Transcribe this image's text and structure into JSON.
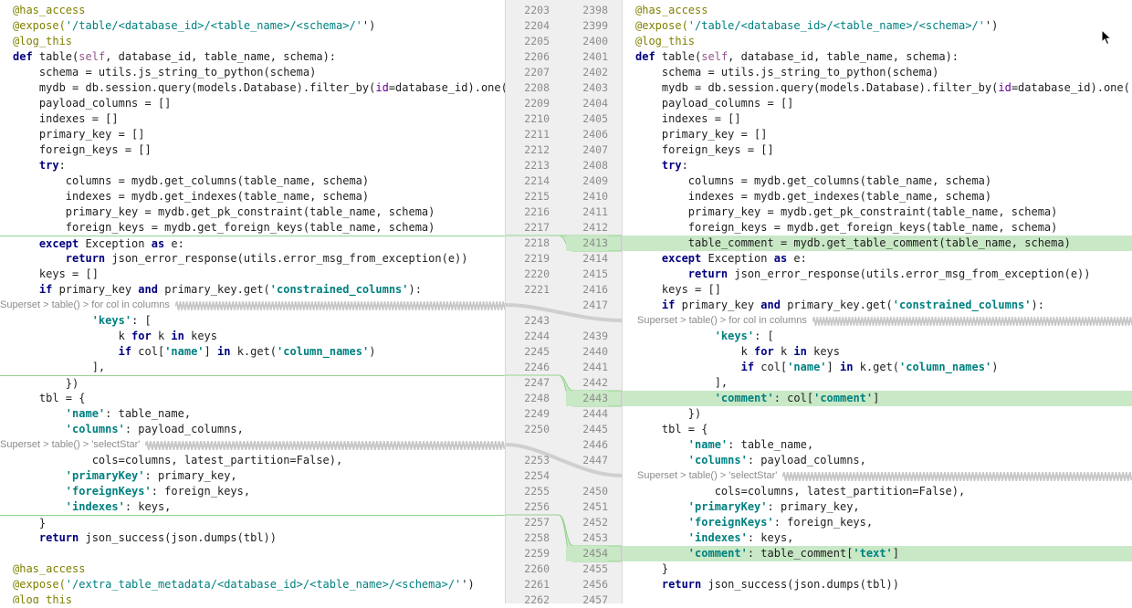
{
  "left": [
    {
      "t": "code",
      "n": "2203",
      "c": [
        [
          "d",
          "@has_access"
        ]
      ]
    },
    {
      "t": "code",
      "n": "2204",
      "c": [
        [
          "d",
          "@expose("
        ],
        [
          "sp",
          "'/table/<database_id>/<table_name>/<schema>/'"
        ],
        [
          "",
          "')"
        ]
      ]
    },
    {
      "t": "code",
      "n": "2205",
      "c": [
        [
          "d",
          "@log_this"
        ]
      ]
    },
    {
      "t": "code",
      "n": "2206",
      "c": [
        [
          "k",
          "def "
        ],
        [
          "",
          "table("
        ],
        [
          "sf",
          "self"
        ],
        [
          "",
          ", database_id, table_name, schema):"
        ]
      ]
    },
    {
      "t": "code",
      "n": "2207",
      "c": [
        [
          "",
          "    schema = utils.js_string_to_python(schema)"
        ]
      ]
    },
    {
      "t": "code",
      "n": "2208",
      "c": [
        [
          "",
          "    mydb = db.session.query(models.Database).filter_by("
        ],
        [
          "pr",
          "id"
        ],
        [
          "",
          "=database_id).one()"
        ]
      ]
    },
    {
      "t": "code",
      "n": "2209",
      "c": [
        [
          "",
          "    payload_columns = []"
        ]
      ]
    },
    {
      "t": "code",
      "n": "2210",
      "c": [
        [
          "",
          "    indexes = []"
        ]
      ]
    },
    {
      "t": "code",
      "n": "2211",
      "c": [
        [
          "",
          "    primary_key = []"
        ]
      ]
    },
    {
      "t": "code",
      "n": "2212",
      "c": [
        [
          "",
          "    foreign_keys = []"
        ]
      ]
    },
    {
      "t": "code",
      "n": "2213",
      "c": [
        [
          "k",
          "    try"
        ],
        [
          "",
          ":"
        ]
      ]
    },
    {
      "t": "code",
      "n": "2214",
      "c": [
        [
          "",
          "        columns = mydb.get_columns(table_name, schema)"
        ]
      ]
    },
    {
      "t": "code",
      "n": "2215",
      "c": [
        [
          "",
          "        indexes = mydb.get_indexes(table_name, schema)"
        ]
      ]
    },
    {
      "t": "code",
      "n": "2216",
      "c": [
        [
          "",
          "        primary_key = mydb.get_pk_constraint(table_name, schema)"
        ]
      ]
    },
    {
      "t": "code",
      "n": "2217",
      "c": [
        [
          "",
          "        foreign_keys = mydb.get_foreign_keys(table_name, schema)"
        ]
      ]
    },
    {
      "t": "code",
      "n": "2218",
      "mark": true,
      "c": [
        [
          "k",
          "    except "
        ],
        [
          "",
          "Exception "
        ],
        [
          "k",
          "as "
        ],
        [
          "",
          "e:"
        ]
      ]
    },
    {
      "t": "code",
      "n": "2219",
      "c": [
        [
          "k",
          "        return "
        ],
        [
          "",
          "json_error_response(utils.error_msg_from_exception(e))"
        ]
      ]
    },
    {
      "t": "code",
      "n": "2220",
      "c": [
        [
          "",
          "    keys = []"
        ]
      ]
    },
    {
      "t": "code",
      "n": "2221",
      "c": [
        [
          "k",
          "    if "
        ],
        [
          "",
          "primary_key "
        ],
        [
          "k",
          "and "
        ],
        [
          "",
          "primary_key.get("
        ],
        [
          "s",
          "'constrained_columns'"
        ],
        [
          "",
          "):"
        ]
      ]
    },
    {
      "t": "fold",
      "n": "",
      "label": "Superset > table() > for col in columns"
    },
    {
      "t": "code",
      "n": "2243",
      "c": [
        [
          "",
          "            "
        ],
        [
          "s",
          "'keys'"
        ],
        [
          "",
          ": ["
        ]
      ]
    },
    {
      "t": "code",
      "n": "2244",
      "c": [
        [
          "",
          "                k "
        ],
        [
          "k",
          "for "
        ],
        [
          "",
          "k "
        ],
        [
          "k",
          "in "
        ],
        [
          "",
          "keys"
        ]
      ]
    },
    {
      "t": "code",
      "n": "2245",
      "c": [
        [
          "k",
          "                if "
        ],
        [
          "",
          "col["
        ],
        [
          "s",
          "'name'"
        ],
        [
          "",
          "] "
        ],
        [
          "k",
          "in "
        ],
        [
          "",
          "k.get("
        ],
        [
          "s",
          "'column_names'"
        ],
        [
          "",
          ")"
        ]
      ]
    },
    {
      "t": "code",
      "n": "2246",
      "c": [
        [
          "",
          "            ],"
        ]
      ]
    },
    {
      "t": "code",
      "n": "2247",
      "mark": true,
      "c": [
        [
          "",
          "        })"
        ]
      ]
    },
    {
      "t": "code",
      "n": "2248",
      "c": [
        [
          "",
          "    tbl = {"
        ]
      ]
    },
    {
      "t": "code",
      "n": "2249",
      "c": [
        [
          "",
          "        "
        ],
        [
          "s",
          "'name'"
        ],
        [
          "",
          ": table_name,"
        ]
      ]
    },
    {
      "t": "code",
      "n": "2250",
      "c": [
        [
          "",
          "        "
        ],
        [
          "s",
          "'columns'"
        ],
        [
          "",
          ": payload_columns,"
        ]
      ]
    },
    {
      "t": "fold",
      "n": "",
      "label": "Superset > table() > 'selectStar'"
    },
    {
      "t": "code",
      "n": "2253",
      "c": [
        [
          "",
          "            cols=columns, latest_partition=False),"
        ]
      ]
    },
    {
      "t": "code",
      "n": "2254",
      "c": [
        [
          "",
          "        "
        ],
        [
          "s",
          "'primaryKey'"
        ],
        [
          "",
          ": primary_key,"
        ]
      ]
    },
    {
      "t": "code",
      "n": "2255",
      "c": [
        [
          "",
          "        "
        ],
        [
          "s",
          "'foreignKeys'"
        ],
        [
          "",
          ": foreign_keys,"
        ]
      ]
    },
    {
      "t": "code",
      "n": "2256",
      "c": [
        [
          "",
          "        "
        ],
        [
          "s",
          "'indexes'"
        ],
        [
          "",
          ": keys,"
        ]
      ]
    },
    {
      "t": "code",
      "n": "2257",
      "mark": true,
      "c": [
        [
          "",
          "    }"
        ]
      ]
    },
    {
      "t": "code",
      "n": "2258",
      "c": [
        [
          "k",
          "    return "
        ],
        [
          "",
          "json_success(json.dumps(tbl))"
        ]
      ]
    },
    {
      "t": "code",
      "n": "2259",
      "c": [
        [
          "",
          ""
        ]
      ]
    },
    {
      "t": "code",
      "n": "2260",
      "c": [
        [
          "d",
          "@has_access"
        ]
      ]
    },
    {
      "t": "code",
      "n": "2261",
      "c": [
        [
          "d",
          "@expose("
        ],
        [
          "sp",
          "'/extra_table_metadata/<database_id>/<table_name>/<schema>/'"
        ],
        [
          "",
          "')"
        ]
      ]
    },
    {
      "t": "code",
      "n": "2262",
      "c": [
        [
          "d",
          "@log_this"
        ]
      ]
    }
  ],
  "right": [
    {
      "t": "code",
      "n": "2398",
      "c": [
        [
          "d",
          "@has_access"
        ]
      ]
    },
    {
      "t": "code",
      "n": "2399",
      "c": [
        [
          "d",
          "@expose("
        ],
        [
          "sp",
          "'/table/<database_id>/<table_name>/<schema>/'"
        ],
        [
          "",
          "')"
        ]
      ]
    },
    {
      "t": "code",
      "n": "2400",
      "c": [
        [
          "d",
          "@log_this"
        ]
      ]
    },
    {
      "t": "code",
      "n": "2401",
      "c": [
        [
          "k",
          "def "
        ],
        [
          "",
          "table("
        ],
        [
          "sf",
          "self"
        ],
        [
          "",
          ", database_id, table_name, schema):"
        ]
      ]
    },
    {
      "t": "code",
      "n": "2402",
      "c": [
        [
          "",
          "    schema = utils.js_string_to_python(schema)"
        ]
      ]
    },
    {
      "t": "code",
      "n": "2403",
      "c": [
        [
          "",
          "    mydb = db.session.query(models.Database).filter_by("
        ],
        [
          "pr",
          "id"
        ],
        [
          "",
          "=database_id).one()"
        ]
      ]
    },
    {
      "t": "code",
      "n": "2404",
      "c": [
        [
          "",
          "    payload_columns = []"
        ]
      ]
    },
    {
      "t": "code",
      "n": "2405",
      "c": [
        [
          "",
          "    indexes = []"
        ]
      ]
    },
    {
      "t": "code",
      "n": "2406",
      "c": [
        [
          "",
          "    primary_key = []"
        ]
      ]
    },
    {
      "t": "code",
      "n": "2407",
      "c": [
        [
          "",
          "    foreign_keys = []"
        ]
      ]
    },
    {
      "t": "code",
      "n": "2408",
      "c": [
        [
          "k",
          "    try"
        ],
        [
          "",
          ":"
        ]
      ]
    },
    {
      "t": "code",
      "n": "2409",
      "c": [
        [
          "",
          "        columns = mydb.get_columns(table_name, schema)"
        ]
      ]
    },
    {
      "t": "code",
      "n": "2410",
      "c": [
        [
          "",
          "        indexes = mydb.get_indexes(table_name, schema)"
        ]
      ]
    },
    {
      "t": "code",
      "n": "2411",
      "c": [
        [
          "",
          "        primary_key = mydb.get_pk_constraint(table_name, schema)"
        ]
      ]
    },
    {
      "t": "code",
      "n": "2412",
      "c": [
        [
          "",
          "        foreign_keys = mydb.get_foreign_keys(table_name, schema)"
        ]
      ]
    },
    {
      "t": "code",
      "n": "2413",
      "hl": true,
      "c": [
        [
          "",
          "        table_comment = mydb.get_table_comment(table_name, schema)"
        ]
      ]
    },
    {
      "t": "code",
      "n": "2414",
      "c": [
        [
          "k",
          "    except "
        ],
        [
          "",
          "Exception "
        ],
        [
          "k",
          "as "
        ],
        [
          "",
          "e:"
        ]
      ]
    },
    {
      "t": "code",
      "n": "2415",
      "c": [
        [
          "k",
          "        return "
        ],
        [
          "",
          "json_error_response(utils.error_msg_from_exception(e))"
        ]
      ]
    },
    {
      "t": "code",
      "n": "2416",
      "c": [
        [
          "",
          "    keys = []"
        ]
      ]
    },
    {
      "t": "code",
      "n": "2417",
      "c": [
        [
          "k",
          "    if "
        ],
        [
          "",
          "primary_key "
        ],
        [
          "k",
          "and "
        ],
        [
          "",
          "primary_key.get("
        ],
        [
          "s",
          "'constrained_columns'"
        ],
        [
          "",
          "):"
        ]
      ]
    },
    {
      "t": "fold",
      "n": "",
      "label": "Superset > table() > for col in columns"
    },
    {
      "t": "code",
      "n": "2439",
      "c": [
        [
          "",
          "            "
        ],
        [
          "s",
          "'keys'"
        ],
        [
          "",
          ": ["
        ]
      ]
    },
    {
      "t": "code",
      "n": "2440",
      "c": [
        [
          "",
          "                k "
        ],
        [
          "k",
          "for "
        ],
        [
          "",
          "k "
        ],
        [
          "k",
          "in "
        ],
        [
          "",
          "keys"
        ]
      ]
    },
    {
      "t": "code",
      "n": "2441",
      "c": [
        [
          "k",
          "                if "
        ],
        [
          "",
          "col["
        ],
        [
          "s",
          "'name'"
        ],
        [
          "",
          "] "
        ],
        [
          "k",
          "in "
        ],
        [
          "",
          "k.get("
        ],
        [
          "s",
          "'column_names'"
        ],
        [
          "",
          ")"
        ]
      ]
    },
    {
      "t": "code",
      "n": "2442",
      "c": [
        [
          "",
          "            ],"
        ]
      ]
    },
    {
      "t": "code",
      "n": "2443",
      "hl": true,
      "c": [
        [
          "",
          "            "
        ],
        [
          "s",
          "'comment'"
        ],
        [
          "",
          ": col["
        ],
        [
          "s",
          "'comment'"
        ],
        [
          "",
          "]"
        ]
      ]
    },
    {
      "t": "code",
      "n": "2444",
      "c": [
        [
          "",
          "        })"
        ]
      ]
    },
    {
      "t": "code",
      "n": "2445",
      "c": [
        [
          "",
          "    tbl = {"
        ]
      ]
    },
    {
      "t": "code",
      "n": "2446",
      "c": [
        [
          "",
          "        "
        ],
        [
          "s",
          "'name'"
        ],
        [
          "",
          ": table_name,"
        ]
      ]
    },
    {
      "t": "code",
      "n": "2447",
      "c": [
        [
          "",
          "        "
        ],
        [
          "s",
          "'columns'"
        ],
        [
          "",
          ": payload_columns,"
        ]
      ]
    },
    {
      "t": "fold",
      "n": "",
      "label": "Superset > table() > 'selectStar'"
    },
    {
      "t": "code",
      "n": "2450",
      "c": [
        [
          "",
          "            cols=columns, latest_partition=False),"
        ]
      ]
    },
    {
      "t": "code",
      "n": "2451",
      "c": [
        [
          "",
          "        "
        ],
        [
          "s",
          "'primaryKey'"
        ],
        [
          "",
          ": primary_key,"
        ]
      ]
    },
    {
      "t": "code",
      "n": "2452",
      "c": [
        [
          "",
          "        "
        ],
        [
          "s",
          "'foreignKeys'"
        ],
        [
          "",
          ": foreign_keys,"
        ]
      ]
    },
    {
      "t": "code",
      "n": "2453",
      "c": [
        [
          "",
          "        "
        ],
        [
          "s",
          "'indexes'"
        ],
        [
          "",
          ": keys,"
        ]
      ]
    },
    {
      "t": "code",
      "n": "2454",
      "hl": true,
      "c": [
        [
          "",
          "        "
        ],
        [
          "s",
          "'comment'"
        ],
        [
          "",
          ": table_comment["
        ],
        [
          "s",
          "'text'"
        ],
        [
          "",
          "]"
        ]
      ]
    },
    {
      "t": "code",
      "n": "2455",
      "c": [
        [
          "",
          "    }"
        ]
      ]
    },
    {
      "t": "code",
      "n": "2456",
      "c": [
        [
          "k",
          "    return "
        ],
        [
          "",
          "json_success(json.dumps(tbl))"
        ]
      ]
    },
    {
      "t": "code",
      "n": "2457",
      "c": [
        [
          "",
          ""
        ]
      ]
    }
  ]
}
